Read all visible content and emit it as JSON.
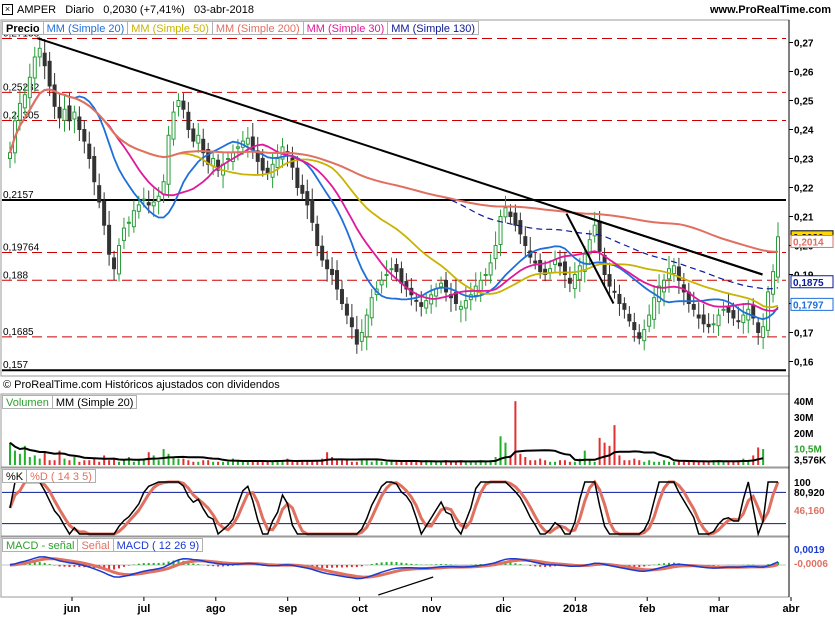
{
  "header": {
    "symbol": "AMPER",
    "period": "Diario",
    "last": "0,2030 (+7,41%)",
    "date": "03-abr-2018",
    "site": "www.ProRealTime.com"
  },
  "price_legend": [
    {
      "text": "Precio",
      "color": "#000000",
      "bold": true
    },
    {
      "text": "MM (Simple 20)",
      "color": "#1e6fd9"
    },
    {
      "text": "MM (Simple 50)",
      "color": "#c8b400"
    },
    {
      "text": "MM (Simple 200)",
      "color": "#e07060"
    },
    {
      "text": "MM (Simple 30)",
      "color": "#e0189a"
    },
    {
      "text": "MM (Simple 130)",
      "color": "#0a1a9a"
    }
  ],
  "credit": "© ProRealTime.com  Históricos ajustados con dividendos",
  "volume_legend": [
    {
      "text": "Volumen",
      "color": "#2ca02c"
    },
    {
      "text": "MM (Simple 20)",
      "color": "#000000"
    }
  ],
  "stoch_legend": [
    {
      "text": "%K",
      "color": "#000000"
    },
    {
      "text": "%D ( 14 3 5)",
      "color": "#e07060"
    }
  ],
  "macd_legend": [
    {
      "text": "MACD - señal",
      "color": "#2ca02c"
    },
    {
      "text": "Señal",
      "color": "#e07060"
    },
    {
      "text": "MACD ( 12 26 9)",
      "color": "#1a3ad0"
    }
  ],
  "colors": {
    "up": "#2a9d3a",
    "down": "#333333",
    "sma20": "#1e6fd9",
    "sma50": "#c8b400",
    "sma200": "#e07060",
    "sma30": "#e0189a",
    "sma130": "#0a1a9a",
    "level": "#cc0000"
  },
  "chart_data": {
    "type": "candlestick",
    "x_ticks": [
      "jun",
      "jul",
      "ago",
      "sep",
      "oct",
      "nov",
      "dic",
      "2018",
      "feb",
      "mar",
      "abr"
    ],
    "price": {
      "ylim": [
        0.155,
        0.275
      ],
      "y_ticks": [
        "0,27",
        "0,26",
        "0,25",
        "0,24",
        "0,23",
        "0,22",
        "0,21",
        "0,20",
        "0,19",
        "0,18",
        "0,17",
        "0,16"
      ],
      "y_tick_values": [
        0.27,
        0.26,
        0.25,
        0.24,
        0.23,
        0.22,
        0.21,
        0.2,
        0.19,
        0.18,
        0.17,
        0.16
      ],
      "level_labels": [
        {
          "text": "0,27138",
          "value": 0.2714,
          "dashed": true
        },
        {
          "text": "0,25282",
          "value": 0.2528,
          "dashed": true
        },
        {
          "text": "0,24305",
          "value": 0.2431,
          "dashed": true
        },
        {
          "text": "0,2157",
          "value": 0.2157,
          "dashed": false
        },
        {
          "text": "0,19764",
          "value": 0.1976,
          "dashed": true
        },
        {
          "text": "0,188",
          "value": 0.188,
          "dashed": true
        },
        {
          "text": "0,1685",
          "value": 0.1685,
          "dashed": true
        },
        {
          "text": "0,157",
          "value": 0.157,
          "dashed": false
        }
      ],
      "series": [
        {
          "name": "Precio",
          "values": [
            0.232,
            0.243,
            0.249,
            0.252,
            0.258,
            0.265,
            0.268,
            0.262,
            0.255,
            0.248,
            0.244,
            0.247,
            0.243,
            0.246,
            0.24,
            0.236,
            0.23,
            0.222,
            0.215,
            0.207,
            0.197,
            0.192,
            0.2,
            0.206,
            0.208,
            0.212,
            0.214,
            0.216,
            0.214,
            0.215,
            0.217,
            0.222,
            0.238,
            0.246,
            0.25,
            0.247,
            0.24,
            0.236,
            0.238,
            0.232,
            0.228,
            0.23,
            0.226,
            0.228,
            0.23,
            0.232,
            0.234,
            0.236,
            0.237,
            0.233,
            0.229,
            0.226,
            0.225,
            0.228,
            0.23,
            0.234,
            0.232,
            0.227,
            0.22,
            0.218,
            0.214,
            0.208,
            0.2,
            0.195,
            0.192,
            0.19,
            0.185,
            0.18,
            0.176,
            0.172,
            0.166,
            0.17,
            0.176,
            0.182,
            0.185,
            0.188,
            0.19,
            0.192,
            0.191,
            0.187,
            0.185,
            0.183,
            0.181,
            0.179,
            0.181,
            0.183,
            0.185,
            0.187,
            0.184,
            0.182,
            0.18,
            0.179,
            0.181,
            0.183,
            0.186,
            0.188,
            0.19,
            0.194,
            0.2,
            0.21,
            0.213,
            0.21,
            0.207,
            0.204,
            0.2,
            0.196,
            0.194,
            0.191,
            0.19,
            0.192,
            0.195,
            0.193,
            0.19,
            0.187,
            0.19,
            0.193,
            0.197,
            0.202,
            0.207,
            0.198,
            0.19,
            0.186,
            0.184,
            0.18,
            0.178,
            0.174,
            0.171,
            0.168,
            0.171,
            0.176,
            0.182,
            0.186,
            0.188,
            0.192,
            0.193,
            0.188,
            0.184,
            0.18,
            0.178,
            0.175,
            0.173,
            0.172,
            0.173,
            0.176,
            0.178,
            0.177,
            0.175,
            0.174,
            0.176,
            0.178,
            0.175,
            0.17,
            0.172,
            0.184,
            0.191,
            0.203
          ]
        },
        {
          "name": "MM (Simple 20)"
        },
        {
          "name": "MM (Simple 50)"
        },
        {
          "name": "MM (Simple 200)"
        },
        {
          "name": "MM (Simple 30)"
        },
        {
          "name": "MM (Simple 130)"
        }
      ],
      "last_labels": [
        {
          "text": "0,2030",
          "value": 0.203,
          "bg": "#ffd700",
          "color": "#000000"
        },
        {
          "text": "0,2014",
          "value": 0.2014,
          "bg": "#ffffff",
          "color": "#e07060"
        },
        {
          "text": "0,1875",
          "value": 0.1875,
          "bg": "#ffffff",
          "color": "#0a1a9a"
        },
        {
          "text": "0,1797",
          "value": 0.1797,
          "bg": "#ffffff",
          "color": "#1e6fd9"
        }
      ],
      "trendlines": [
        {
          "from": [
            0.045,
            0.2715
          ],
          "to": [
            0.97,
            0.19
          ]
        },
        {
          "from": [
            0.72,
            0.212
          ],
          "to": [
            0.97,
            0.19
          ]
        },
        {
          "from": [
            0.72,
            0.211
          ],
          "to": [
            0.78,
            0.18
          ]
        }
      ]
    },
    "volume": {
      "y_ticks": [
        "40M",
        "30M",
        "20M"
      ],
      "y_tick_values": [
        40,
        30,
        20
      ],
      "last_labels": [
        {
          "text": "10,5M",
          "value": 10.5,
          "color": "#2ca02c",
          "bg": "#ffffff"
        },
        {
          "text": "3,576K",
          "value": 3.576,
          "color": "#000000",
          "bg": "#ffffff"
        }
      ],
      "values": [
        14,
        9,
        7,
        12,
        5,
        6,
        4,
        8,
        3,
        3,
        9,
        4,
        3,
        5,
        2,
        3,
        3,
        4,
        2,
        6,
        3,
        4,
        2,
        3,
        5,
        2,
        3,
        4,
        8,
        6,
        3,
        10,
        7,
        5,
        4,
        4,
        3,
        2,
        2,
        3,
        3,
        2,
        2,
        2,
        2,
        4,
        3,
        2,
        3,
        2,
        2,
        3,
        2,
        2,
        3,
        3,
        4,
        2,
        2,
        3,
        3,
        2,
        3,
        4,
        8,
        5,
        3,
        3,
        3,
        2,
        2,
        4,
        3,
        2,
        3,
        2,
        2,
        3,
        2,
        2,
        3,
        2,
        2,
        2,
        3,
        2,
        2,
        2,
        3,
        2,
        2,
        3,
        2,
        2,
        2,
        3,
        2,
        3,
        5,
        18,
        14,
        6,
        40,
        7,
        5,
        3,
        3,
        4,
        3,
        2,
        2,
        3,
        3,
        2,
        2,
        4,
        9,
        3,
        2,
        17,
        14,
        12,
        25,
        6,
        3,
        3,
        4,
        3,
        2,
        3,
        2,
        2,
        3,
        2,
        2,
        3,
        2,
        2,
        3,
        2,
        2,
        2,
        3,
        3,
        2,
        2,
        2,
        3,
        4,
        3,
        6,
        11,
        10
      ]
    },
    "stochastic": {
      "ylim": [
        0,
        100
      ],
      "y_ticks": [
        "100"
      ],
      "y_tick_values": [
        100
      ],
      "last_labels": [
        {
          "text": "80,920",
          "value": 80.92,
          "color": "#000000"
        },
        {
          "text": "46,160",
          "value": 46.16,
          "color": "#e07060"
        }
      ]
    },
    "macd": {
      "last_labels": [
        {
          "text": "0,0019",
          "value": 0.0019,
          "color": "#1a3ad0"
        },
        {
          "text": "-0,0006",
          "value": -0.0006,
          "color": "#e07060"
        }
      ]
    }
  }
}
